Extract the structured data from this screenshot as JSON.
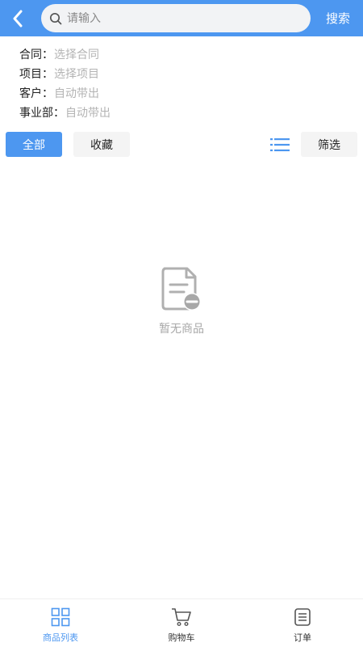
{
  "header": {
    "back_icon": "chevron-left-icon",
    "search_placeholder": "请输入",
    "search_icon": "search-icon",
    "search_button": "搜索"
  },
  "info": {
    "contract": {
      "label": "合同：",
      "value": "选择合同"
    },
    "project": {
      "label": "项目：",
      "value": "选择项目"
    },
    "customer": {
      "label": "客户：",
      "value": "自动带出"
    },
    "department": {
      "label": "事业部：",
      "value": "自动带出"
    }
  },
  "tabs": {
    "all": "全部",
    "favorites": "收藏",
    "list_icon": "list-icon",
    "filter": "筛选"
  },
  "empty": {
    "icon": "empty-document-icon",
    "text": "暂无商品"
  },
  "bottom_nav": {
    "items": [
      {
        "label": "商品列表",
        "icon": "grid-icon",
        "active": true
      },
      {
        "label": "购物车",
        "icon": "cart-icon",
        "active": false
      },
      {
        "label": "订单",
        "icon": "order-list-icon",
        "active": false
      }
    ]
  },
  "colors": {
    "accent": "#4d97f0",
    "muted_text": "#b3b3b3",
    "button_bg": "#f4f4f4"
  }
}
